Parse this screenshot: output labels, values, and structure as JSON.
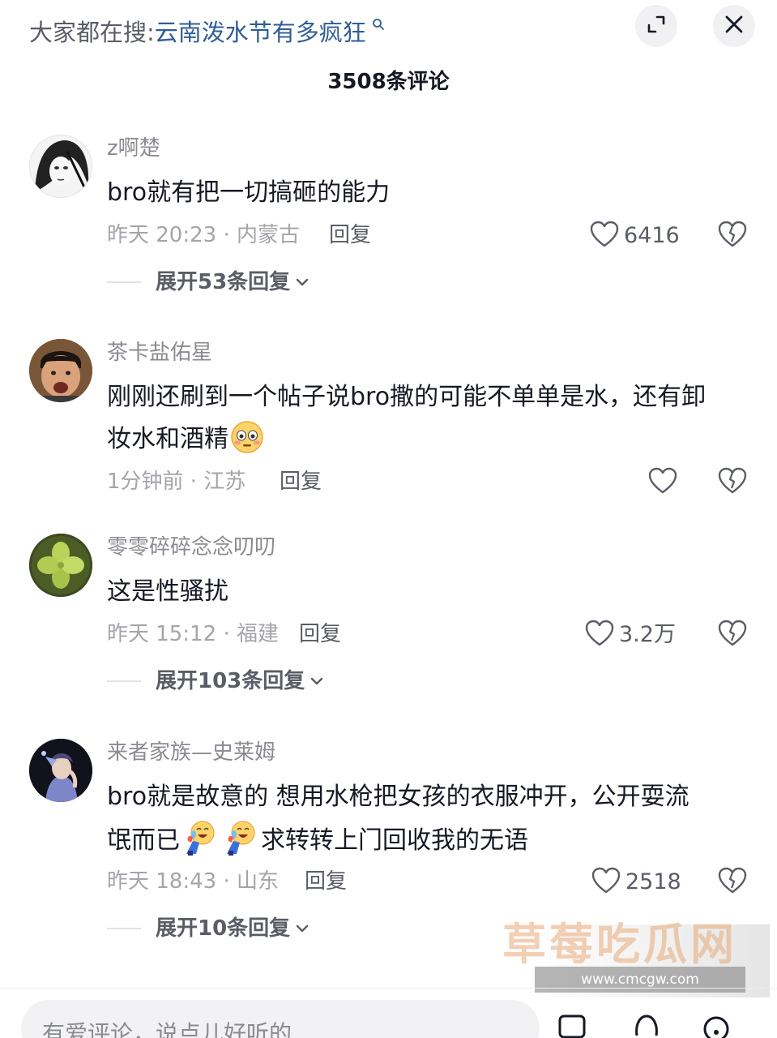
{
  "header": {
    "search_prefix": "大家都在搜:",
    "search_topic": "云南泼水节有多疯狂",
    "expand_icon": "fullscreen-icon",
    "close_icon": "close-icon"
  },
  "comment_count": "3508条评论",
  "comments": [
    {
      "username": "z啊楚",
      "text": "bro就有把一切搞砸的能力",
      "time_location": "昨天 20:23 · 内蒙古",
      "reply_label": "回复",
      "likes": "6416",
      "expand_replies": "展开53条回复"
    },
    {
      "username": "茶卡盐佑星",
      "text_line1": "刚刚还刷到一个帖子说bro撒的可能不单单是水，还有卸",
      "text_line2": "妆水和酒精",
      "text_emoji": "flushed-face-emoji",
      "time_location": "1分钟前 · 江苏",
      "reply_label": "回复",
      "likes": ""
    },
    {
      "username": "零零碎碎念念叨叨",
      "text": "这是性骚扰",
      "time_location": "昨天 15:12 · 福建",
      "reply_label": "回复",
      "likes": "3.2万",
      "expand_replies": "展开103条回复"
    },
    {
      "username": "来者家族—史莱姆",
      "text_line1": "bro就是故意的  想用水枪把女孩的衣服冲开，公开耍流",
      "text_line2_a": "氓而已",
      "text_line2_b": "求转转上门回收我的无语",
      "text_emoji": "crying-laughing-emoji",
      "time_location": "昨天 18:43 · 山东",
      "reply_label": "回复",
      "likes": "2518",
      "expand_replies": "展开10条回复"
    }
  ],
  "watermark": {
    "title": "草莓吃瓜网",
    "url": "www.cmcgw.com"
  },
  "bottom": {
    "input_placeholder": "有爱评论，说点儿好听的"
  },
  "colors": {
    "topic_blue": "#2f5d96",
    "text_primary": "#161823",
    "text_secondary": "#8a8b91",
    "text_meta": "#a4a5aa"
  }
}
